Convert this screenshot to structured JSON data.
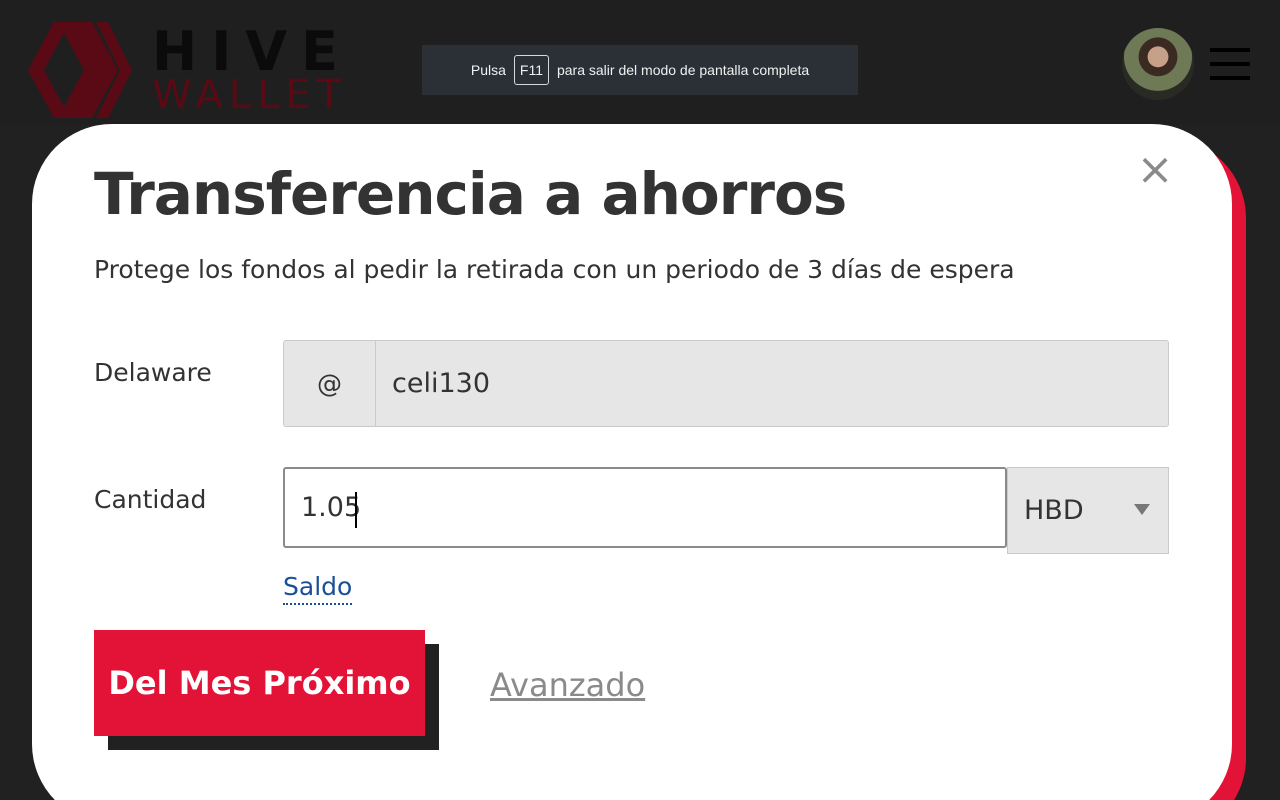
{
  "header": {
    "logo_line1": "HIVE",
    "logo_line2": "WALLET"
  },
  "fullscreen_notice": {
    "before": "Pulsa",
    "key": "F11",
    "after": "para salir del modo de pantalla completa"
  },
  "modal": {
    "title": "Transferencia a ahorros",
    "subtitle": "Protege los fondos al pedir la retirada con un periodo de 3 días de espera",
    "close_symbol": "×",
    "to_label": "Delaware",
    "at_prefix": "@",
    "to_value": "celi130",
    "amount_label": "Cantidad",
    "amount_value": "1.05",
    "asset_selected": "HBD",
    "balance_link": "Saldo",
    "submit_label": "Del Mes Próximo",
    "advanced_link": "Avanzado"
  },
  "colors": {
    "brand_red": "#e31337",
    "background_dark": "#212121",
    "link_blue": "#1a5099"
  },
  "icons": {
    "logo": "hive-logo-icon",
    "close": "close-icon",
    "menu": "hamburger-menu-icon",
    "dropdown": "chevron-down-icon"
  }
}
